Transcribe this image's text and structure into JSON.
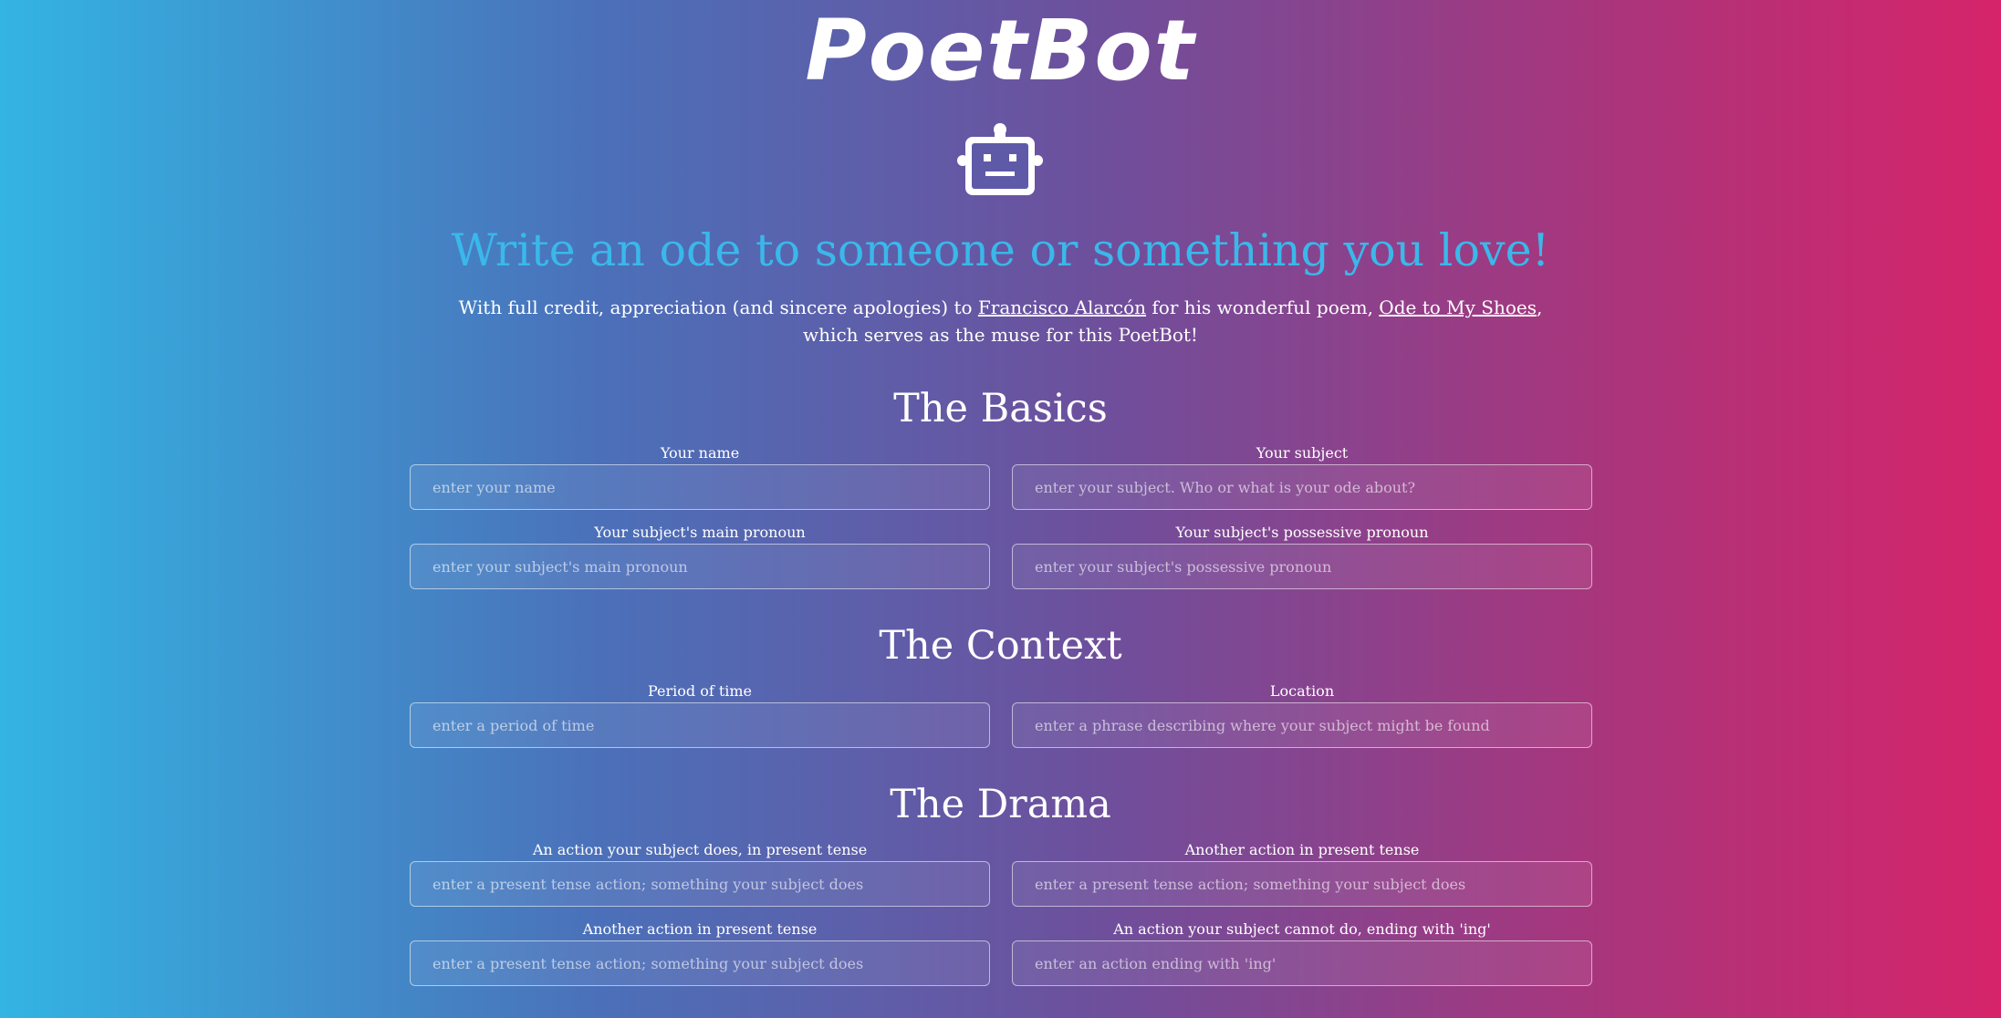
{
  "header": {
    "logo_text": "PoetBot",
    "logo_icon": "robot-icon"
  },
  "intro": {
    "headline": "Write an ode to someone or something you love!",
    "credit_prefix": "With full credit, appreciation (and sincere apologies) to ",
    "author_link": "Francisco Alarcón",
    "credit_middle": " for his wonderful poem, ",
    "poem_link": "Ode to My Shoes",
    "credit_suffix_1": ",",
    "credit_suffix_2": "which serves as the muse for this PoetBot!"
  },
  "basics": {
    "title": "The Basics",
    "name": {
      "label": "Your name",
      "placeholder": "enter your name",
      "value": ""
    },
    "subject": {
      "label": "Your subject",
      "placeholder": "enter your subject. Who or what is your ode about?",
      "value": ""
    },
    "main_pronoun": {
      "label": "Your subject's main pronoun",
      "placeholder": "enter your subject's main pronoun",
      "value": ""
    },
    "possessive_pronoun": {
      "label": "Your subject's possessive pronoun",
      "placeholder": "enter your subject's possessive pronoun",
      "value": ""
    }
  },
  "context": {
    "title": "The Context",
    "period": {
      "label": "Period of time",
      "placeholder": "enter a period of time",
      "value": ""
    },
    "location": {
      "label": "Location",
      "placeholder": "enter a phrase describing where your subject might be found",
      "value": ""
    }
  },
  "drama": {
    "title": "The Drama",
    "action1": {
      "label": "An action your subject does, in present tense",
      "placeholder": "enter a present tense action; something your subject does",
      "value": ""
    },
    "action2": {
      "label": "Another action in present tense",
      "placeholder": "enter a present tense action; something your subject does",
      "value": ""
    },
    "action3": {
      "label": "Another action in present tense",
      "placeholder": "enter a present tense action; something your subject does",
      "value": ""
    },
    "cannot_do": {
      "label": "An action your subject cannot do, ending with 'ing'",
      "placeholder": "enter an action ending with 'ing'",
      "value": ""
    }
  }
}
